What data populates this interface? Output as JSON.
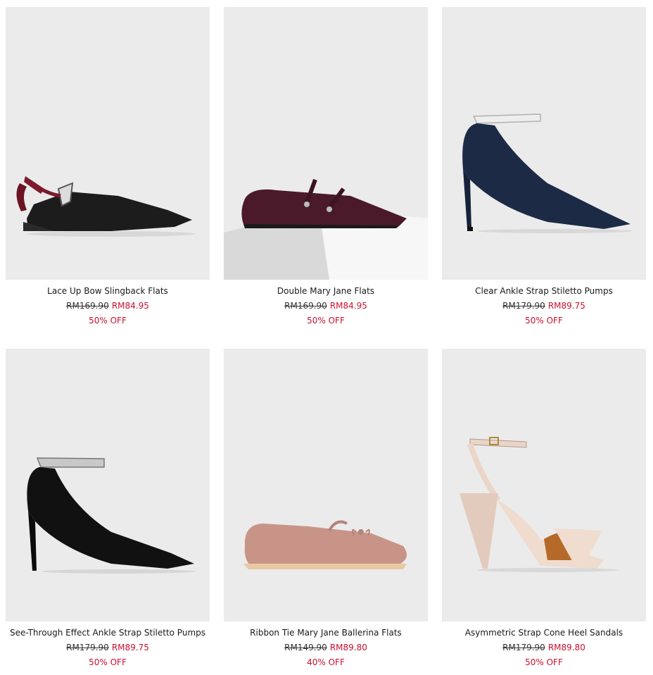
{
  "products": [
    {
      "name": "Lace Up Bow Slingback Flats",
      "original_price": "RM169.90",
      "sale_price": "RM84.95",
      "discount": "50% OFF",
      "image_icon": "black-slingback-flat-with-burgundy-bow"
    },
    {
      "name": "Double Mary Jane Flats",
      "original_price": "RM169.90",
      "sale_price": "RM84.95",
      "discount": "50% OFF",
      "image_icon": "burgundy-double-strap-flat"
    },
    {
      "name": "Clear Ankle Strap Stiletto Pumps",
      "original_price": "RM179.90",
      "sale_price": "RM89.75",
      "discount": "50% OFF",
      "image_icon": "navy-stiletto-pump-clear-strap"
    },
    {
      "name": "See-Through Effect Ankle Strap Stiletto Pumps",
      "original_price": "RM179.90",
      "sale_price": "RM89.75",
      "discount": "50% OFF",
      "image_icon": "black-stiletto-pump-silver-strap"
    },
    {
      "name": "Ribbon Tie Mary Jane Ballerina Flats",
      "original_price": "RM149.90",
      "sale_price": "RM89.80",
      "discount": "40% OFF",
      "image_icon": "pink-ballerina-flat"
    },
    {
      "name": "Asymmetric Strap Cone Heel Sandals",
      "original_price": "RM179.90",
      "sale_price": "RM89.80",
      "discount": "50% OFF",
      "image_icon": "nude-cone-heel-sandal"
    }
  ],
  "colors": {
    "sale": "#c8102e",
    "image_background": "#ebebeb"
  }
}
